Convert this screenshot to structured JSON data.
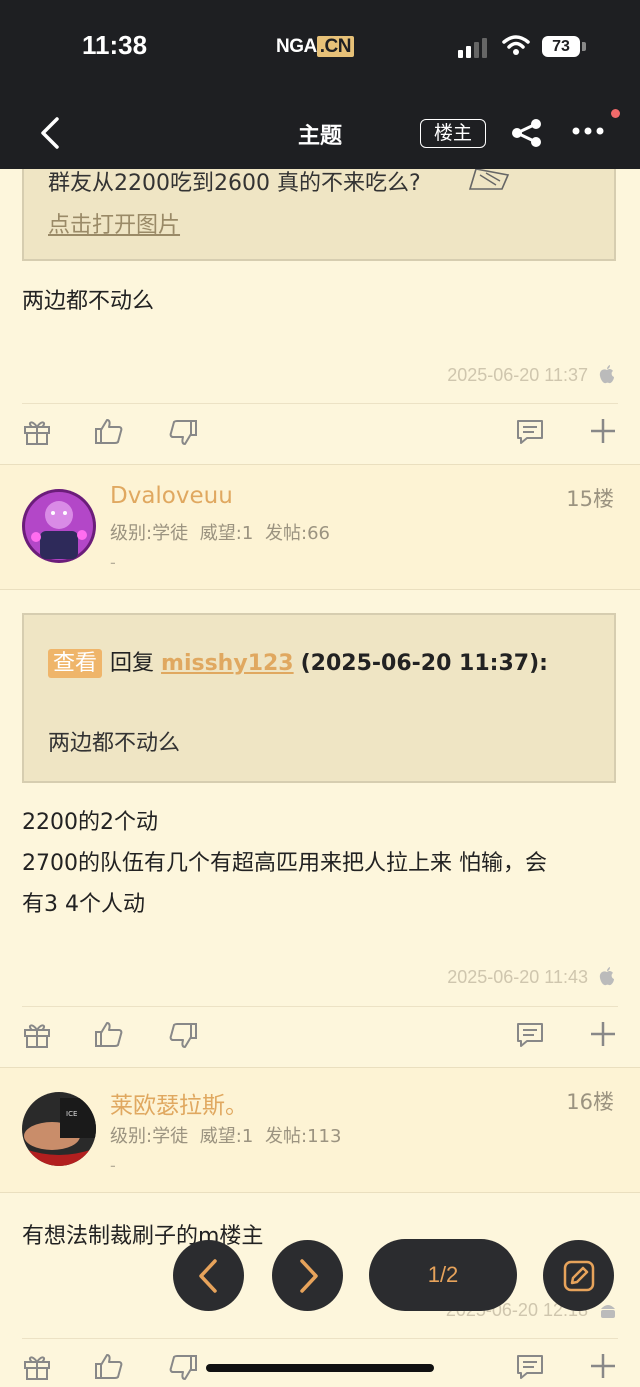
{
  "status": {
    "time": "11:38",
    "logo_main": "NGA",
    "logo_cn": ".CN",
    "battery": "73"
  },
  "nav": {
    "title": "主题",
    "owner_button": "楼主"
  },
  "post14": {
    "quote_text": "群友从2200吃到2600 真的不来吃么?",
    "open_image": "点击打开图片",
    "body": "两边都不动么",
    "timestamp": "2025-06-20 11:37"
  },
  "post15": {
    "username": "Dvaloveuu",
    "floor": "15楼",
    "meta": "级别:学徒 威望:1 发帖:66",
    "dash": "-",
    "reply_tag": "查看",
    "reply_word": "回复",
    "reply_user": "misshy123",
    "reply_date": "(2025-06-20 11:37):",
    "quote_body": "两边都不动么",
    "body_line1": "2200的2个动",
    "body_line2": "2700的队伍有几个有超高匹用来把人拉上来 怕输，会",
    "body_line3": "有3 4个人动",
    "timestamp": "2025-06-20 11:43"
  },
  "post16": {
    "username": "莱欧瑟拉斯。",
    "floor": "16楼",
    "meta": "级别:学徒 威望:1 发帖:113",
    "dash": "-",
    "body": "有想法制裁刷子的m楼主",
    "timestamp": "2025-06-20 12:18"
  },
  "pager": {
    "label": "1/2"
  },
  "colors": {
    "background": "#fdf6dc",
    "dark": "#1e1f22",
    "accent": "#e0a860"
  }
}
